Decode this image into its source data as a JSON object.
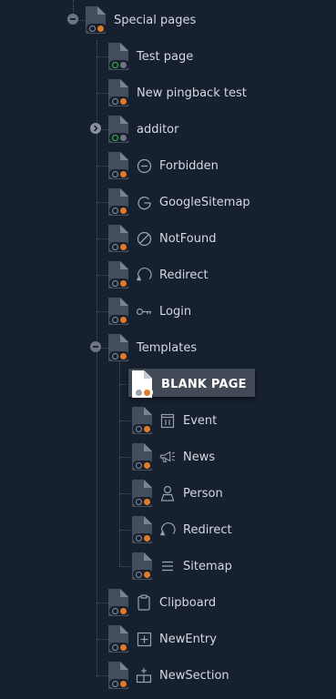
{
  "tree": {
    "special_pages": {
      "label": "Special pages",
      "icon": "page-icon",
      "expanded": true
    },
    "test_page": {
      "label": "Test page",
      "status": "online"
    },
    "new_pingback": {
      "label": "New pingback test"
    },
    "additor": {
      "label": "additor",
      "status": "online",
      "expandable": true
    },
    "forbidden": {
      "label": "Forbidden",
      "icon": "forbidden-icon"
    },
    "googlesitemap": {
      "label": "GoogleSitemap",
      "icon": "google-icon"
    },
    "notfound": {
      "label": "NotFound",
      "icon": "notfound-icon"
    },
    "redirect": {
      "label": "Redirect",
      "icon": "redirect-icon"
    },
    "login": {
      "label": "Login",
      "icon": "key-icon"
    },
    "templates": {
      "label": "Templates",
      "expanded": true
    },
    "blank_page": {
      "label": "BLANK PAGE",
      "selected": true
    },
    "event": {
      "label": "Event",
      "icon": "calendar-icon"
    },
    "news": {
      "label": "News",
      "icon": "megaphone-icon"
    },
    "person": {
      "label": "Person",
      "icon": "person-icon"
    },
    "redirect2": {
      "label": "Redirect",
      "icon": "redirect-icon"
    },
    "sitemap": {
      "label": "Sitemap",
      "icon": "list-icon"
    },
    "clipboard": {
      "label": "Clipboard",
      "icon": "clipboard-icon"
    },
    "newentry": {
      "label": "NewEntry",
      "icon": "plus-box-icon"
    },
    "newsection": {
      "label": "NewSection",
      "icon": "new-section-icon"
    }
  },
  "colors": {
    "background": "#16202f",
    "text": "#d4d9e1",
    "online": "#3dbb4a",
    "offline": "#e27b28",
    "selected_bg": "#424a57"
  }
}
